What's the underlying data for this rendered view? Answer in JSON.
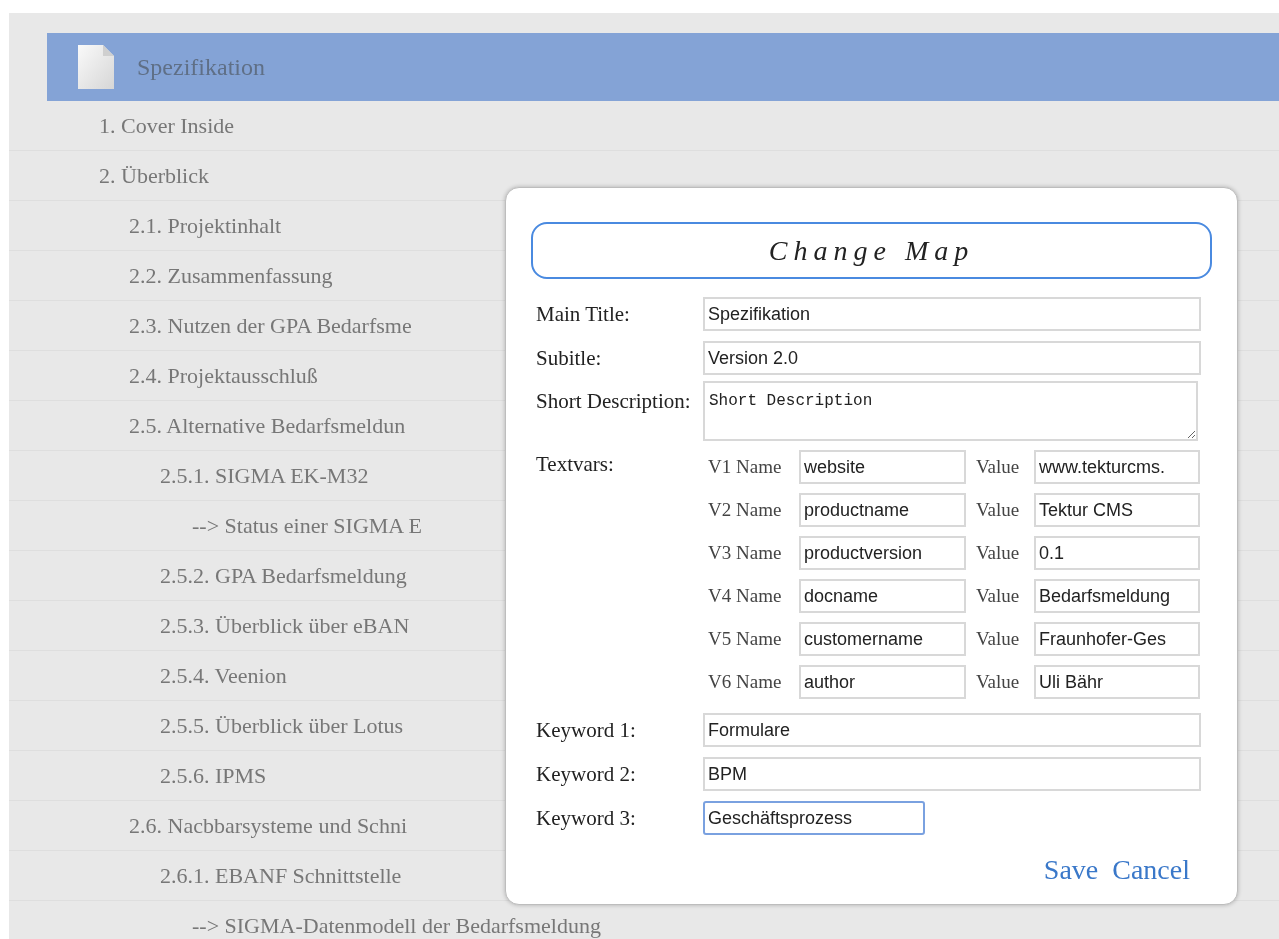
{
  "tree": {
    "root": {
      "label": "Spezifikation",
      "selected": true
    },
    "items": [
      {
        "label": "1. Cover Inside"
      },
      {
        "label": "2. Überblick",
        "children": [
          {
            "label": "2.1. Projektinhalt"
          },
          {
            "label": "2.2. Zusammenfassung"
          },
          {
            "label": "2.3. Nutzen der GPA Bedarfsme"
          },
          {
            "label": "2.4. Projektausschluß"
          },
          {
            "label": "2.5. Alternative Bedarfsmeldun",
            "children": [
              {
                "label": "2.5.1. SIGMA EK-M32",
                "children": [
                  {
                    "label": "--> Status einer SIGMA E"
                  }
                ]
              },
              {
                "label": "2.5.2. GPA Bedarfsmeldung"
              },
              {
                "label": "2.5.3. Überblick über eBAN"
              },
              {
                "label": "2.5.4. Veenion"
              },
              {
                "label": "2.5.5. Überblick über Lotus"
              },
              {
                "label": "2.5.6. IPMS"
              }
            ]
          },
          {
            "label": "2.6. Nacbbarsysteme und Schni",
            "children": [
              {
                "label": "2.6.1. EBANF Schnittstelle",
                "children": [
                  {
                    "label": "--> SIGMA-Datenmodell der Bedarfsmeldung"
                  }
                ]
              }
            ]
          }
        ]
      }
    ]
  },
  "dialog": {
    "title": "Change Map",
    "main_title": {
      "label": "Main Title:",
      "value": "Spezifikation"
    },
    "subtitle": {
      "label": "Subitle:",
      "value": "Version 2.0"
    },
    "short_description": {
      "label": "Short Description:",
      "value": "Short Description"
    },
    "textvars": {
      "label": "Textvars:",
      "rows": [
        {
          "name_label": "V1 Name",
          "name": "website",
          "value_label": "Value",
          "value": "www.tekturcms."
        },
        {
          "name_label": "V2 Name",
          "name": "productname",
          "value_label": "Value",
          "value": "Tektur CMS"
        },
        {
          "name_label": "V3 Name",
          "name": "productversion",
          "value_label": "Value",
          "value": "0.1"
        },
        {
          "name_label": "V4 Name",
          "name": "docname",
          "value_label": "Value",
          "value": "Bedarfsmeldung"
        },
        {
          "name_label": "V5 Name",
          "name": "customername",
          "value_label": "Value",
          "value": "Fraunhofer-Ges"
        },
        {
          "name_label": "V6 Name",
          "name": "author",
          "value_label": "Value",
          "value": "Uli Bähr"
        }
      ]
    },
    "keywords": [
      {
        "label": "Keyword 1:",
        "value": "Formulare",
        "focused": false
      },
      {
        "label": "Keyword 2:",
        "value": "BPM",
        "focused": false
      },
      {
        "label": "Keyword 3:",
        "value": "Geschäftsprozess",
        "focused": true
      }
    ],
    "buttons": [
      "Save",
      "Cancel"
    ]
  }
}
